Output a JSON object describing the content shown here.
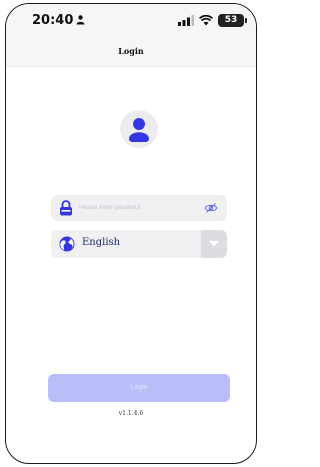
{
  "status_bar": {
    "time": "20:40",
    "battery": "53"
  },
  "header": {
    "title": "Login"
  },
  "login_form": {
    "password": {
      "placeholder": "Please enter password",
      "value": ""
    },
    "language": {
      "selected": "English"
    },
    "login_label": "Login"
  },
  "footer": {
    "version": "v1.1.4.6"
  },
  "colors": {
    "accent": "#3436e0",
    "login_disabled": "#b9bdf8",
    "field_bg": "#f0f0f3"
  },
  "icons": [
    "person-icon",
    "signal-icon",
    "wifi-icon",
    "battery-icon",
    "user-avatar-icon",
    "lock-icon",
    "eye-off-icon",
    "globe-icon",
    "chevron-down-icon"
  ]
}
